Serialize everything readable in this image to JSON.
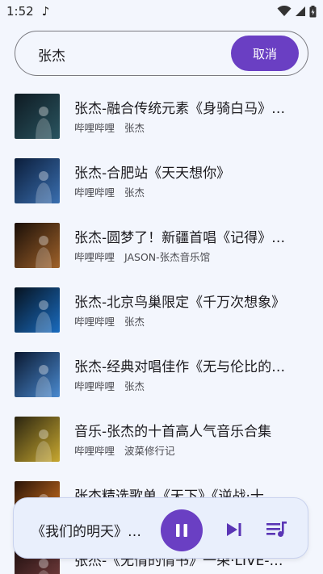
{
  "status_bar": {
    "time": "1:52",
    "music_icon": "music-note-icon",
    "wifi_icon": "wifi-icon",
    "signal_icon": "signal-icon",
    "battery_icon": "battery-icon"
  },
  "search": {
    "query": "张杰",
    "cancel_label": "取消"
  },
  "results": [
    {
      "title": "张杰-融合传统元素《身骑白马》…",
      "source": "哔哩哔哩",
      "author": "张杰",
      "thumb_colors": [
        "#0e1a22",
        "#2a5560"
      ]
    },
    {
      "title": "张杰-合肥站《天天想你》",
      "source": "哔哩哔哩",
      "author": "张杰",
      "thumb_colors": [
        "#0b1d3a",
        "#3a6fb0"
      ]
    },
    {
      "title": "张杰-圆梦了！新疆首唱《记得》…",
      "source": "哔哩哔哩",
      "author": "JASON-张杰音乐馆",
      "thumb_colors": [
        "#1a0f08",
        "#a0622a"
      ]
    },
    {
      "title": "张杰-北京鸟巢限定《千万次想象》",
      "source": "哔哩哔哩",
      "author": "张杰",
      "thumb_colors": [
        "#06121f",
        "#1a6cc0"
      ]
    },
    {
      "title": "张杰-经典对唱佳作《无与伦比的…",
      "source": "哔哩哔哩",
      "author": "张杰",
      "thumb_colors": [
        "#0a1830",
        "#4a8ad0"
      ]
    },
    {
      "title": "音乐-张杰的十首高人气音乐合集",
      "source": "哔哩哔哩",
      "author": "波菜修行记",
      "thumb_colors": [
        "#2a2410",
        "#c8a830"
      ]
    },
    {
      "title": "张杰精选歌单《天下》《逆战·十…",
      "source": "",
      "author": "",
      "thumb_colors": [
        "#2a1408",
        "#e07a20"
      ]
    },
    {
      "title": "张杰-《无情的情书》一朵·LIVE-…",
      "source": "",
      "author": "",
      "thumb_colors": [
        "#201010",
        "#7a4040"
      ]
    }
  ],
  "player": {
    "now_playing": "《我们的明天》…",
    "pause_icon": "pause-icon",
    "next_icon": "skip-next-icon",
    "queue_icon": "playlist-icon",
    "accent": "#6a3fc3"
  }
}
